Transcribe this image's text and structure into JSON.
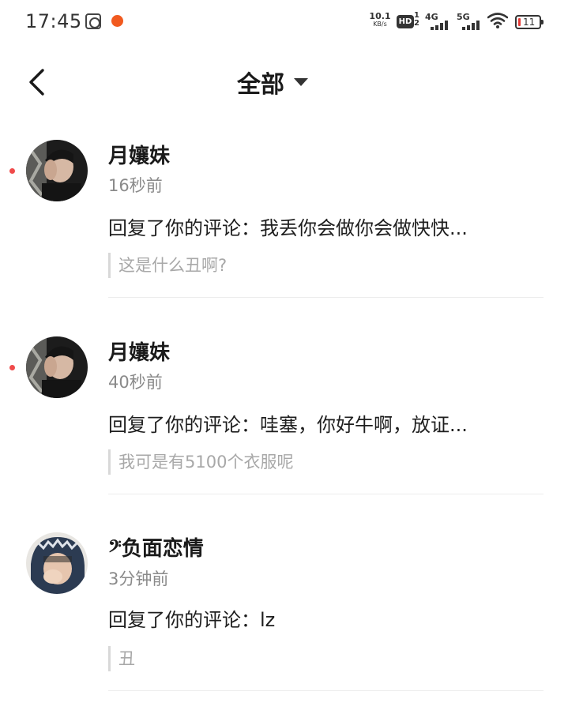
{
  "status_bar": {
    "time": "17:45",
    "net_speed": "10.1",
    "net_speed_unit": "KB/s",
    "hd_label": "HD",
    "hd_sub_top": "1",
    "hd_sub_bottom": "2",
    "network_1": "4G",
    "network_2": "5G",
    "battery": "11",
    "battery_color": "#e53935"
  },
  "header": {
    "title": "全部",
    "back_icon": "chevron-left-icon",
    "dropdown_icon": "caret-down-icon"
  },
  "notifications": [
    {
      "user": "月孃妹",
      "time": "16秒前",
      "reply": "回复了你的评论：我丢你会做你会做快快...",
      "quote": "这是什么丑啊?",
      "unread": true
    },
    {
      "user": "月孃妹",
      "time": "40秒前",
      "reply": "回复了你的评论：哇塞，你好牛啊，放证...",
      "quote": "我可是有5100个衣服呢",
      "unread": true
    },
    {
      "user": "𝄢负面恋情",
      "time": "3分钟前",
      "reply": "回复了你的评论：lz",
      "quote": "丑",
      "unread": false
    }
  ],
  "colors": {
    "unread_dot": "#f04a4a",
    "time_text": "#8a8a8a",
    "quote_text": "#a8a8a8"
  }
}
